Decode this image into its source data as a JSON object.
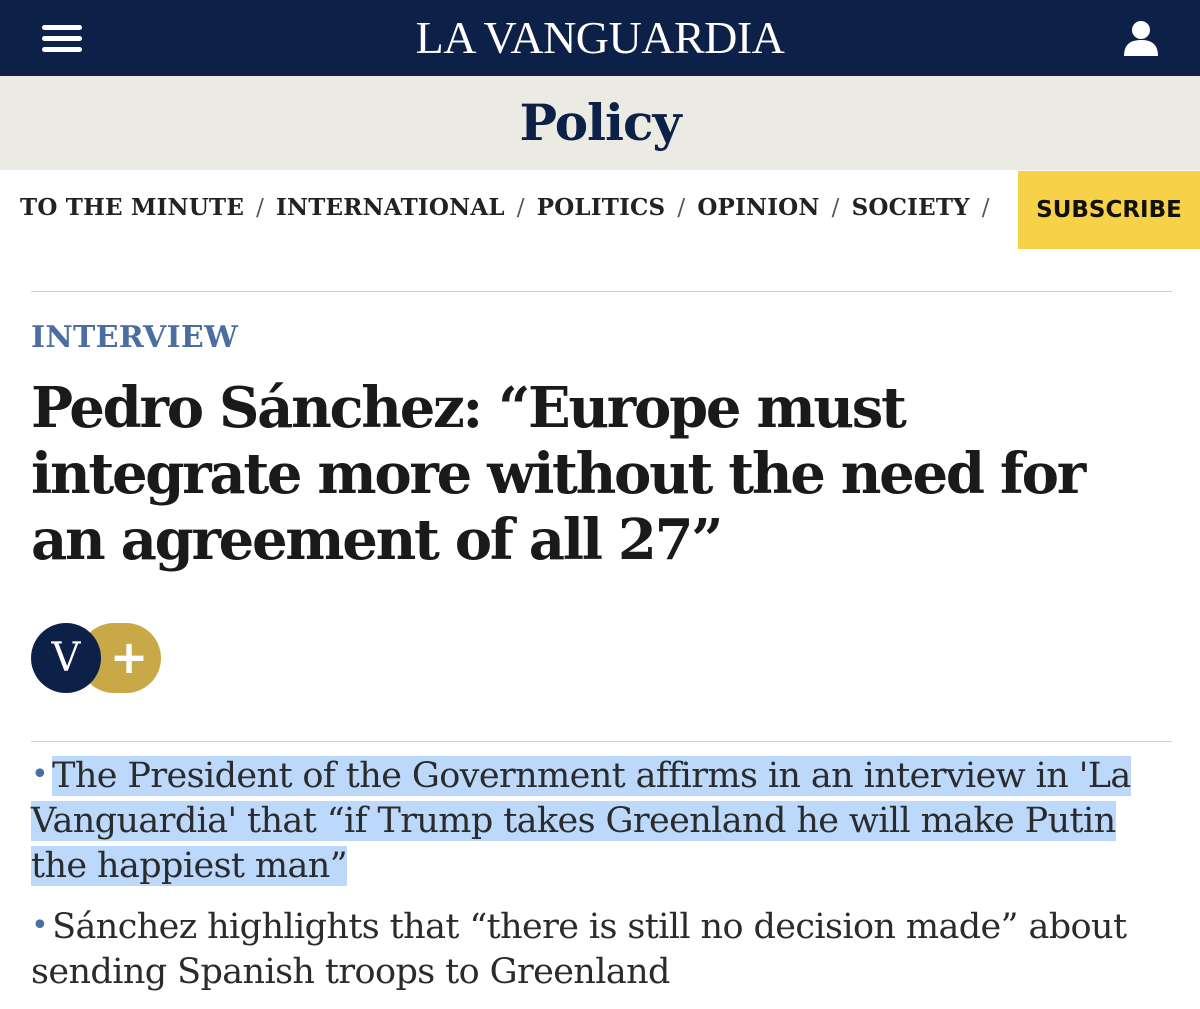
{
  "header": {
    "logo": "LA VANGUARDIA",
    "menu_icon": "hamburger-menu-icon",
    "user_icon": "user-account-icon",
    "colors": {
      "bar": "#0d2148",
      "band": "#ebebe3"
    }
  },
  "section": {
    "title": "Policy"
  },
  "nav": {
    "items": [
      "TO THE MINUTE",
      "INTERNATIONAL",
      "POLITICS",
      "OPINION",
      "SOCIETY"
    ],
    "separator": "/",
    "subscribe": "SUBSCRIBE",
    "subscribe_color": "#f7d148"
  },
  "article": {
    "kicker": "INTERVIEW",
    "kicker_color": "#4b6ea0",
    "headline": "Pedro Sánchez: “Europe must integrate more without the need for an agreement of all 27”",
    "badge": {
      "letter": "V",
      "plus": "+",
      "colors": {
        "circle": "#0d2148",
        "pill": "#c9a848"
      }
    },
    "bullets": [
      {
        "text": "The President of the Government affirms in an interview in 'La Vanguardia' that “if Trump takes Greenland he will make Putin the happiest man”",
        "highlighted": true
      },
      {
        "text": "Sánchez highlights that “there is still no decision made” about sending Spanish troops to Greenland",
        "highlighted": false
      }
    ],
    "bullet_symbol": "•",
    "highlight_color": "#bcd8fb"
  }
}
